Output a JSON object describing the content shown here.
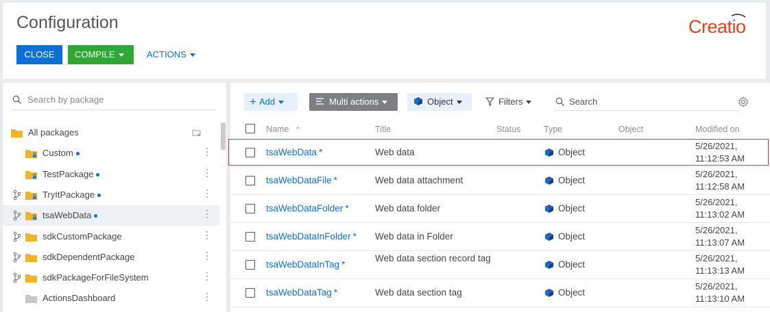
{
  "header": {
    "title": "Configuration",
    "logo": "Creatio",
    "buttons": {
      "close": "CLOSE",
      "compile": "COMPILE",
      "actions": "ACTIONS"
    }
  },
  "sidebar": {
    "search_placeholder": "Search by package",
    "items": [
      {
        "label": "All packages",
        "git": false,
        "dot": false,
        "icon": "folder-icon"
      },
      {
        "label": "Custom",
        "git": false,
        "dot": true,
        "icon": "locked-folder-icon"
      },
      {
        "label": "TestPackage",
        "git": false,
        "dot": true,
        "icon": "locked-folder-icon"
      },
      {
        "label": "TryItPackage",
        "git": true,
        "dot": true,
        "icon": "locked-folder-icon"
      },
      {
        "label": "tsaWebData",
        "git": true,
        "dot": true,
        "icon": "locked-folder-icon",
        "selected": true
      },
      {
        "label": "sdkCustomPackage",
        "git": true,
        "dot": false,
        "icon": "folder-icon"
      },
      {
        "label": "sdkDependentPackage",
        "git": true,
        "dot": false,
        "icon": "folder-icon"
      },
      {
        "label": "sdkPackageForFileSystem",
        "git": true,
        "dot": false,
        "icon": "folder-icon"
      },
      {
        "label": "ActionsDashboard",
        "git": false,
        "dot": false,
        "icon": "gray-folder-icon"
      }
    ]
  },
  "toolbar": {
    "add": "Add",
    "multi_actions": "Multi actions",
    "object": "Object",
    "filters": "Filters",
    "search_placeholder": "Search"
  },
  "grid": {
    "columns": {
      "name": "Name",
      "title": "Title",
      "status": "Status",
      "type": "Type",
      "object": "Object",
      "modified": "Modified on"
    },
    "rows": [
      {
        "name": "tsaWebData",
        "title": "Web data",
        "type": "Object",
        "date": "5/26/2021,",
        "time": "11:12:53 AM"
      },
      {
        "name": "tsaWebDataFile",
        "title": "Web data attachment",
        "type": "Object",
        "date": "5/26/2021,",
        "time": "11:12:58 AM"
      },
      {
        "name": "tsaWebDataFolder",
        "title": "Web data folder",
        "type": "Object",
        "date": "5/26/2021,",
        "time": "11:13:02 AM"
      },
      {
        "name": "tsaWebDataInFolder",
        "title": "Web data in Folder",
        "type": "Object",
        "date": "5/26/2021,",
        "time": "11:13:07 AM"
      },
      {
        "name": "tsaWebDataInTag",
        "title": "Web data section record tag",
        "type": "Object",
        "date": "5/26/2021,",
        "time": "11:13:13 AM"
      },
      {
        "name": "tsaWebDataTag",
        "title": "Web data section tag",
        "type": "Object",
        "date": "5/26/2021,",
        "time": "11:13:10 AM"
      }
    ],
    "star": "*"
  },
  "colors": {
    "accent": "#0d6fd6",
    "compile": "#2fa836",
    "logo": "#e8401c",
    "highlight": "#d9352b"
  }
}
